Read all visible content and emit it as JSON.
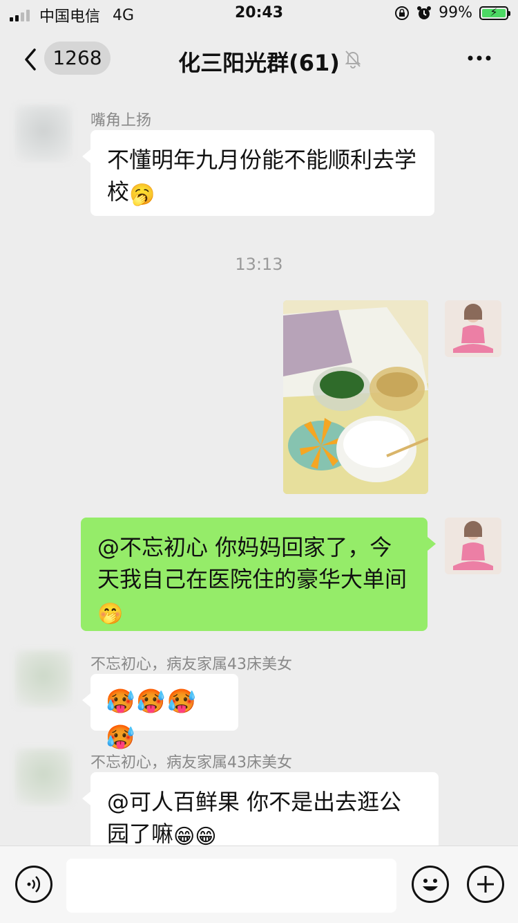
{
  "status_bar": {
    "carrier": "中国电信",
    "network": "4G",
    "time": "20:43",
    "battery": "99%",
    "battery_level": 0.99
  },
  "nav": {
    "unread_count": "1268",
    "title": "化三阳光群(61)"
  },
  "messages": [
    {
      "nickname": "嘴角上扬",
      "text": "不懂明年九月份能不能顺利去学校",
      "emoji": "🥱"
    },
    {
      "time": "13:13"
    },
    {
      "self_mention": "@不忘初心",
      "text": " 你妈妈回家了，今天我自己在医院住的豪华大单间",
      "emoji": "🤭"
    },
    {
      "nickname": "不忘初心，病友家属43床美女",
      "emoji_row": "🥵🥵🥵🥵"
    },
    {
      "nickname": "不忘初心，病友家属43床美女",
      "text": "@可人百鲜果 你不是出去逛公园了嘛",
      "emoji": "😁😁"
    }
  ]
}
